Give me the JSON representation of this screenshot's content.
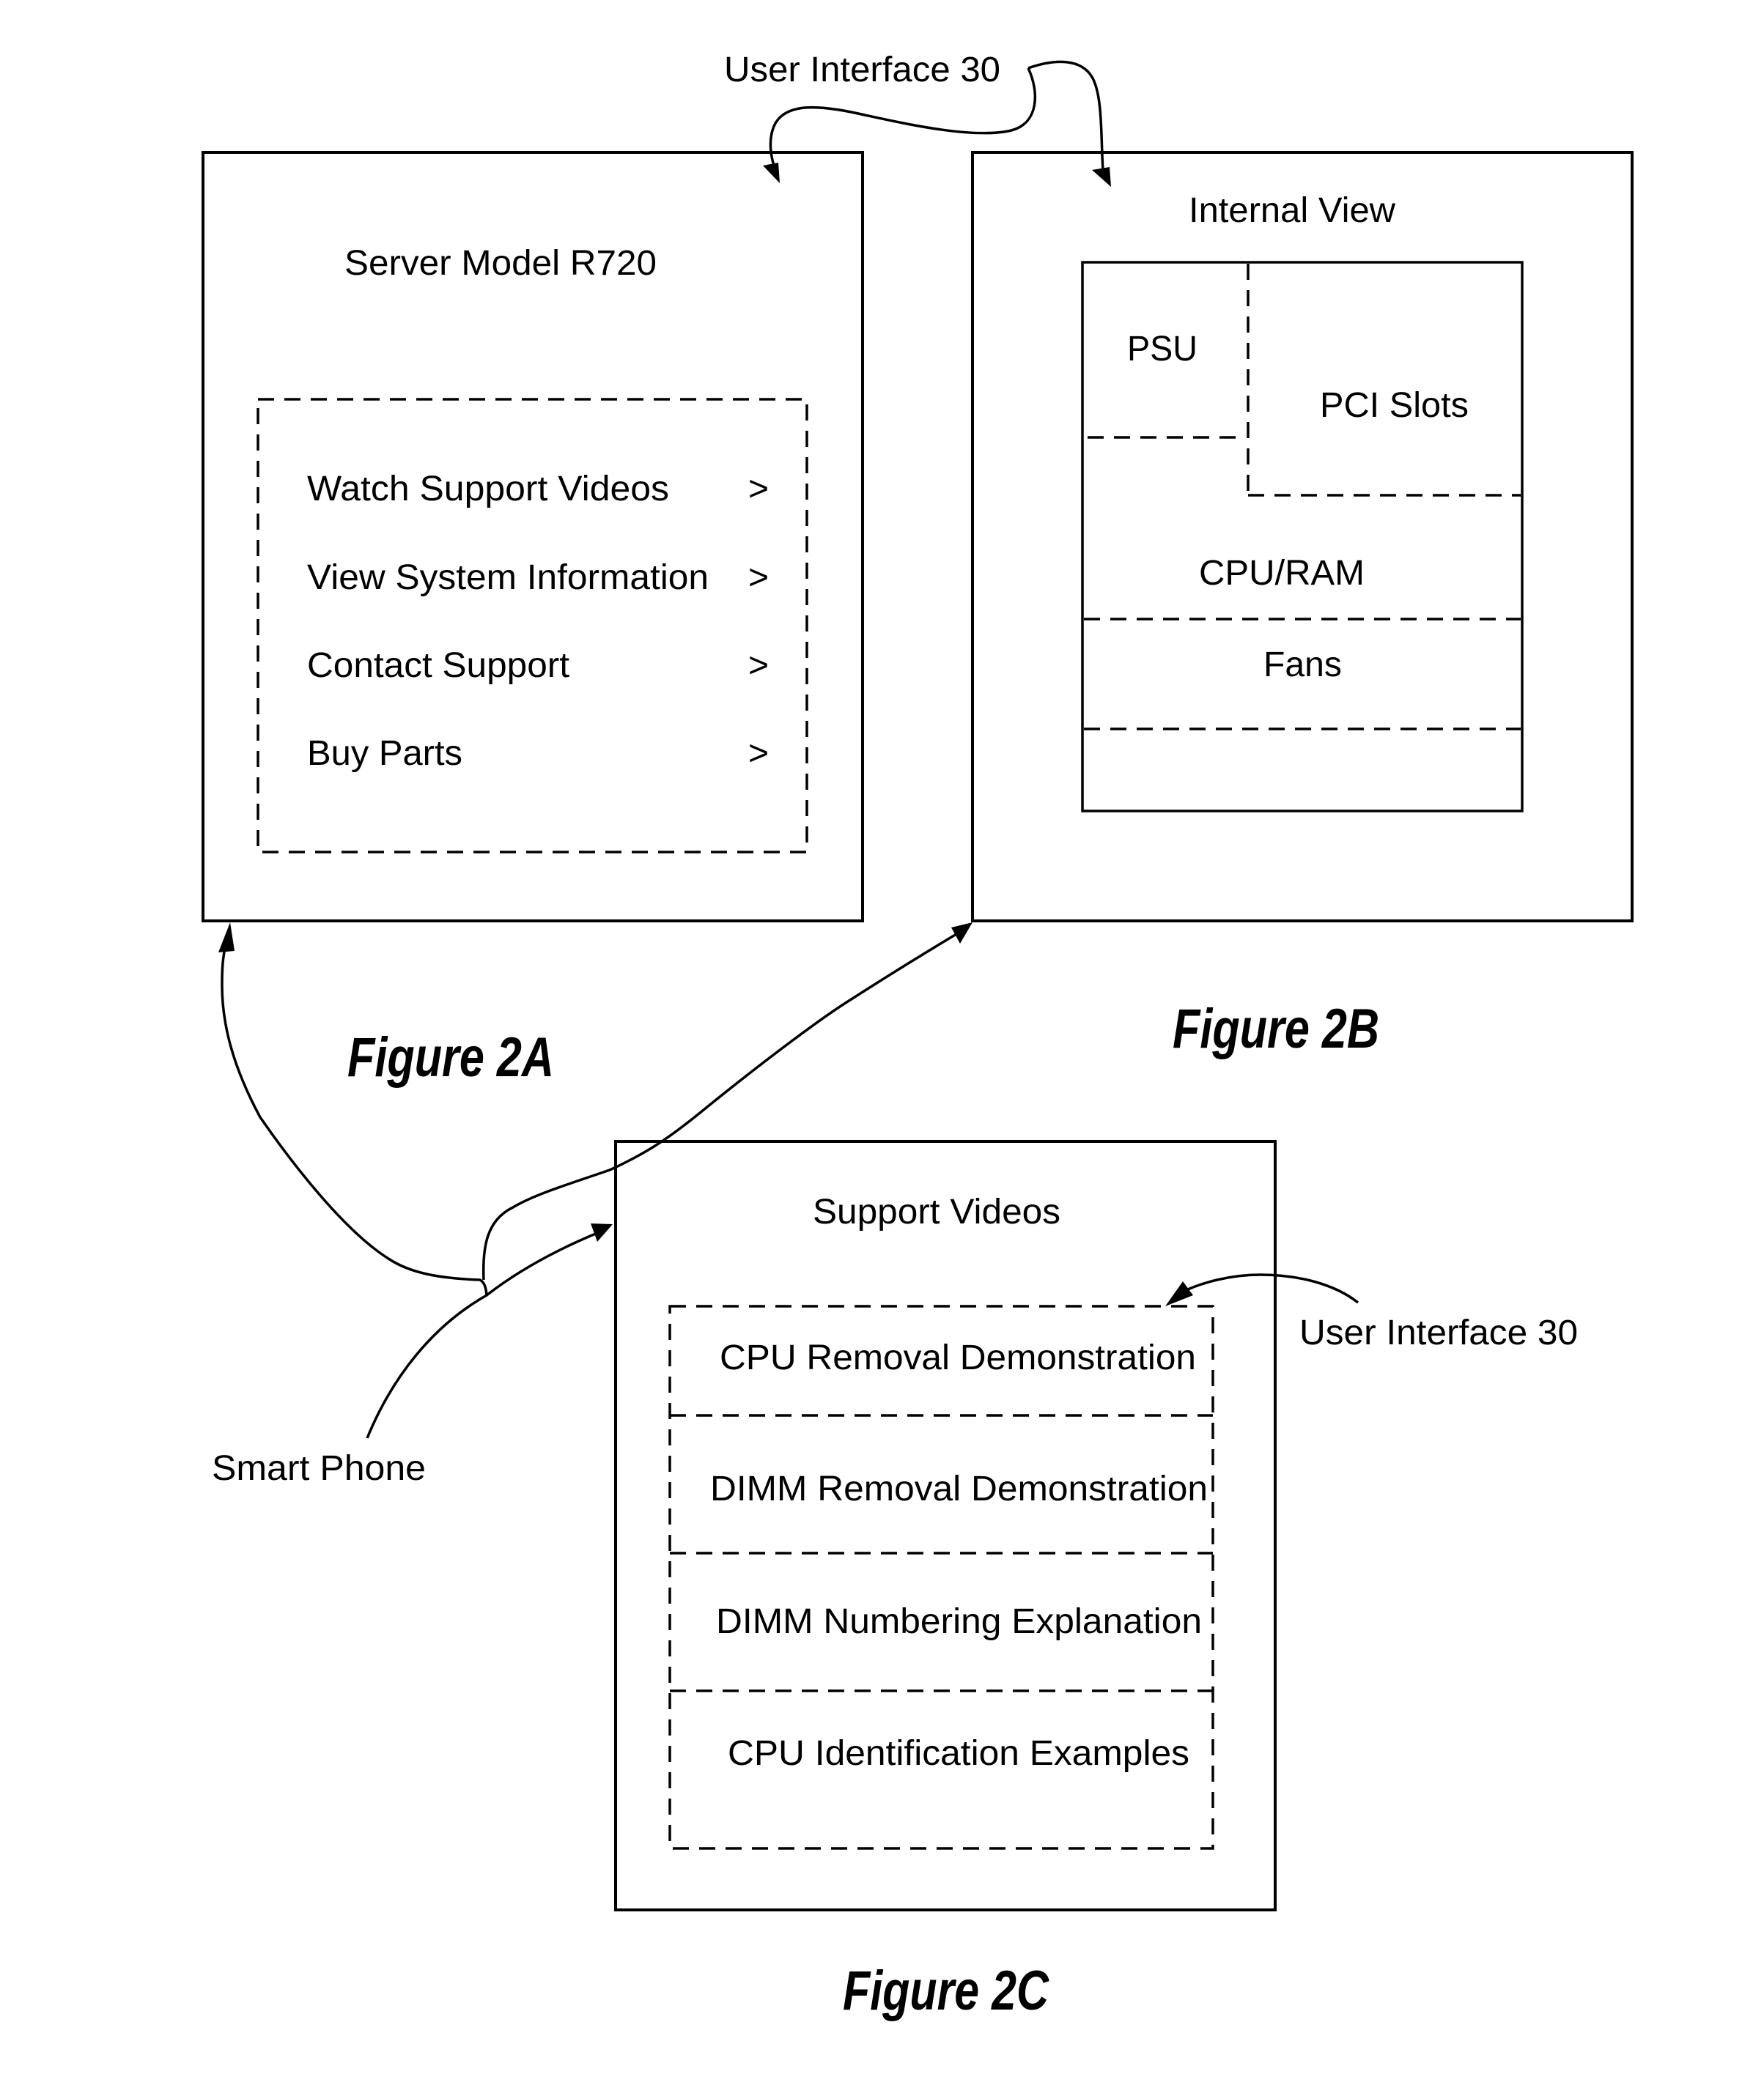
{
  "annotations": {
    "ui_label_top": "User Interface 30",
    "ui_label_bottom": "User Interface 30",
    "device_label": "Smart Phone"
  },
  "figure_2a": {
    "caption": "Figure 2A",
    "title": "Server Model R720",
    "menu_items": [
      {
        "label": "Watch Support Videos",
        "chevron": ">"
      },
      {
        "label": "View System Information",
        "chevron": ">"
      },
      {
        "label": "Contact Support",
        "chevron": ">"
      },
      {
        "label": "Buy Parts",
        "chevron": ">"
      }
    ]
  },
  "figure_2b": {
    "caption": "Figure 2B",
    "title": "Internal View",
    "regions": {
      "psu": "PSU",
      "pci": "PCI Slots",
      "cpu_ram": "CPU/RAM",
      "fans": "Fans"
    }
  },
  "figure_2c": {
    "caption": "Figure 2C",
    "title": "Support Videos",
    "videos": [
      "CPU Removal Demonstration",
      "DIMM Removal Demonstration",
      "DIMM Numbering Explanation",
      "CPU Identification Examples"
    ]
  }
}
